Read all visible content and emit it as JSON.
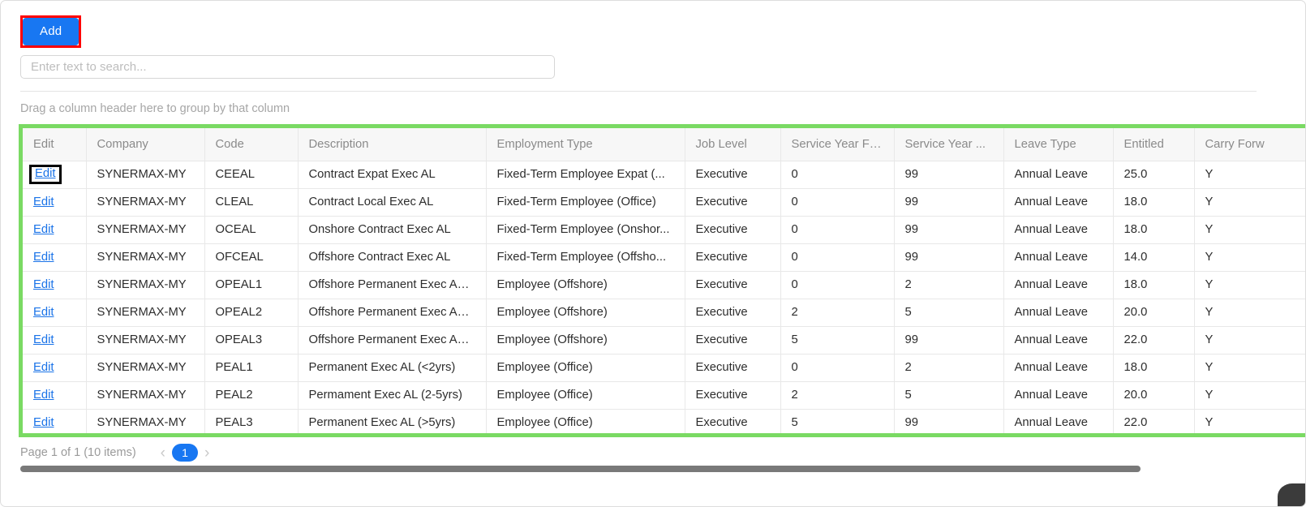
{
  "toolbar": {
    "add_label": "Add",
    "highlight_color": "#ff0000",
    "button_color": "#1877f2"
  },
  "search": {
    "value": "",
    "placeholder": "Enter text to search..."
  },
  "group_panel": {
    "text": "Drag a column header here to group by that column"
  },
  "grid": {
    "highlight_color": "#7ada63",
    "columns": [
      {
        "label": "Edit",
        "align": "left"
      },
      {
        "label": "Company",
        "align": "left"
      },
      {
        "label": "Code",
        "align": "left"
      },
      {
        "label": "Description",
        "align": "left"
      },
      {
        "label": "Employment Type",
        "align": "left"
      },
      {
        "label": "Job Level",
        "align": "left"
      },
      {
        "label": "Service Year From",
        "align": "right"
      },
      {
        "label": "Service Year ...",
        "align": "right"
      },
      {
        "label": "Leave Type",
        "align": "left"
      },
      {
        "label": "Entitled",
        "align": "right"
      },
      {
        "label": "Carry Forw",
        "align": "left"
      }
    ],
    "edit_label": "Edit",
    "rows": [
      {
        "company": "SYNERMAX-MY",
        "code": "CEEAL",
        "description": "Contract Expat Exec AL",
        "employment_type": "Fixed-Term Employee Expat (...",
        "job_level": "Executive",
        "service_year_from": "0",
        "service_year_to": "99",
        "leave_type": "Annual Leave",
        "entitled": "25.0",
        "carry_forward": "Y"
      },
      {
        "company": "SYNERMAX-MY",
        "code": "CLEAL",
        "description": "Contract Local Exec AL",
        "employment_type": "Fixed-Term Employee (Office)",
        "job_level": "Executive",
        "service_year_from": "0",
        "service_year_to": "99",
        "leave_type": "Annual Leave",
        "entitled": "18.0",
        "carry_forward": "Y"
      },
      {
        "company": "SYNERMAX-MY",
        "code": "OCEAL",
        "description": "Onshore Contract Exec AL",
        "employment_type": "Fixed-Term Employee (Onshor...",
        "job_level": "Executive",
        "service_year_from": "0",
        "service_year_to": "99",
        "leave_type": "Annual Leave",
        "entitled": "18.0",
        "carry_forward": "Y"
      },
      {
        "company": "SYNERMAX-MY",
        "code": "OFCEAL",
        "description": "Offshore Contract Exec AL",
        "employment_type": "Fixed-Term Employee (Offsho...",
        "job_level": "Executive",
        "service_year_from": "0",
        "service_year_to": "99",
        "leave_type": "Annual Leave",
        "entitled": "14.0",
        "carry_forward": "Y"
      },
      {
        "company": "SYNERMAX-MY",
        "code": "OPEAL1",
        "description": "Offshore Permanent Exec AL (...",
        "employment_type": "Employee (Offshore)",
        "job_level": "Executive",
        "service_year_from": "0",
        "service_year_to": "2",
        "leave_type": "Annual Leave",
        "entitled": "18.0",
        "carry_forward": "Y"
      },
      {
        "company": "SYNERMAX-MY",
        "code": "OPEAL2",
        "description": "Offshore Permanent Exec AL (...",
        "employment_type": "Employee (Offshore)",
        "job_level": "Executive",
        "service_year_from": "2",
        "service_year_to": "5",
        "leave_type": "Annual Leave",
        "entitled": "20.0",
        "carry_forward": "Y"
      },
      {
        "company": "SYNERMAX-MY",
        "code": "OPEAL3",
        "description": "Offshore Permanent Exec AL (...",
        "employment_type": "Employee (Offshore)",
        "job_level": "Executive",
        "service_year_from": "5",
        "service_year_to": "99",
        "leave_type": "Annual Leave",
        "entitled": "22.0",
        "carry_forward": "Y"
      },
      {
        "company": "SYNERMAX-MY",
        "code": "PEAL1",
        "description": "Permanent Exec AL (<2yrs)",
        "employment_type": "Employee (Office)",
        "job_level": "Executive",
        "service_year_from": "0",
        "service_year_to": "2",
        "leave_type": "Annual Leave",
        "entitled": "18.0",
        "carry_forward": "Y"
      },
      {
        "company": "SYNERMAX-MY",
        "code": "PEAL2",
        "description": "Permament Exec AL (2-5yrs)",
        "employment_type": "Employee (Office)",
        "job_level": "Executive",
        "service_year_from": "2",
        "service_year_to": "5",
        "leave_type": "Annual Leave",
        "entitled": "20.0",
        "carry_forward": "Y"
      },
      {
        "company": "SYNERMAX-MY",
        "code": "PEAL3",
        "description": "Permanent Exec AL (>5yrs)",
        "employment_type": "Employee (Office)",
        "job_level": "Executive",
        "service_year_from": "5",
        "service_year_to": "99",
        "leave_type": "Annual Leave",
        "entitled": "22.0",
        "carry_forward": "Y"
      }
    ]
  },
  "pager": {
    "summary": "Page 1 of 1 (10 items)",
    "prev_icon": "‹",
    "next_icon": "›",
    "current_page": "1"
  }
}
